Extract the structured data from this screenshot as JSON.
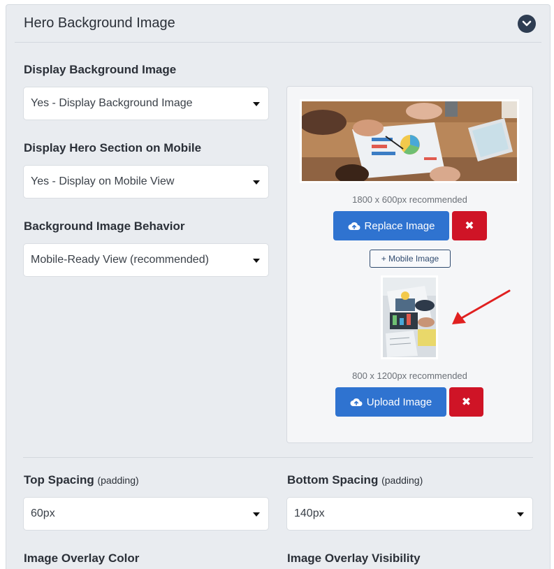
{
  "panel": {
    "title": "Hero Background Image"
  },
  "fields": {
    "display_bg": {
      "label": "Display Background Image",
      "value": "Yes - Display Background Image"
    },
    "display_mobile": {
      "label": "Display Hero Section on Mobile",
      "value": "Yes - Display on Mobile View"
    },
    "bg_behavior": {
      "label": "Background Image Behavior",
      "value": "Mobile-Ready View (recommended)"
    },
    "top_spacing": {
      "label": "Top Spacing",
      "sub": "(padding)",
      "value": "60px"
    },
    "bottom_spacing": {
      "label": "Bottom Spacing",
      "sub": "(padding)",
      "value": "140px"
    },
    "overlay_color": {
      "label": "Image Overlay Color"
    },
    "overlay_visibility": {
      "label": "Image Overlay Visibility"
    }
  },
  "images": {
    "desktop_recommended": "1800 x 600px recommended",
    "replace_label": "Replace Image",
    "mobile_button_label": "+ Mobile Image",
    "mobile_recommended": "800 x 1200px recommended",
    "upload_label": "Upload Image",
    "remove_symbol": "✖"
  },
  "colors": {
    "primary": "#2f73d0",
    "danger": "#cf1426",
    "panel_bg": "#e9ecf0",
    "annotation_arrow": "#e02020"
  },
  "icons": [
    "chevron-down-icon",
    "cloud-upload-icon",
    "close-icon",
    "caret-down-icon",
    "red-arrow-annotation"
  ]
}
